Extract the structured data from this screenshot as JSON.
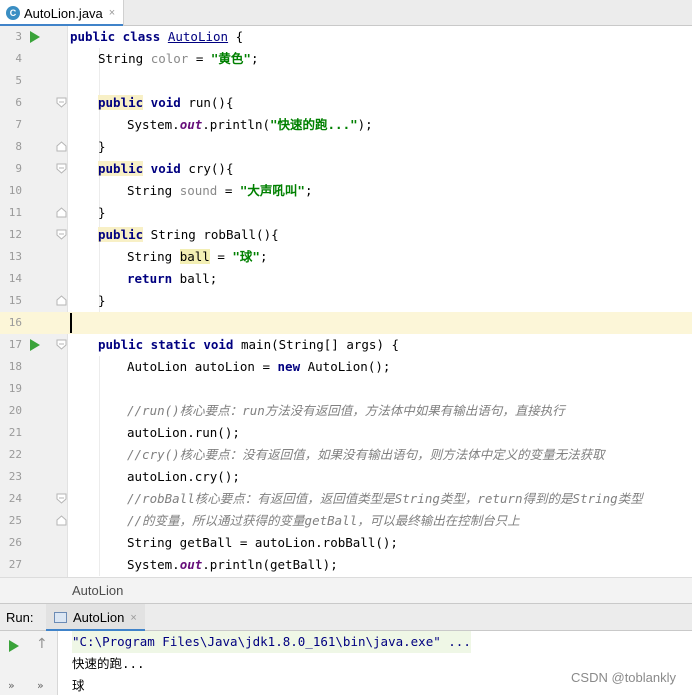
{
  "editor": {
    "tab": {
      "icon": "java-class-icon",
      "badge": "C",
      "label": "AutoLion.java",
      "close": "×"
    },
    "lines": [
      {
        "num": "3"
      },
      {
        "num": "4"
      },
      {
        "num": "5"
      },
      {
        "num": "6"
      },
      {
        "num": "7"
      },
      {
        "num": "8"
      },
      {
        "num": "9"
      },
      {
        "num": "10"
      },
      {
        "num": "11"
      },
      {
        "num": "12"
      },
      {
        "num": "13"
      },
      {
        "num": "14"
      },
      {
        "num": "15"
      },
      {
        "num": "16"
      },
      {
        "num": "17"
      },
      {
        "num": "18"
      },
      {
        "num": "19"
      },
      {
        "num": "20"
      },
      {
        "num": "21"
      },
      {
        "num": "22"
      },
      {
        "num": "23"
      },
      {
        "num": "24"
      },
      {
        "num": "25"
      },
      {
        "num": "26"
      },
      {
        "num": "27"
      }
    ],
    "code": {
      "l3": {
        "kw": "public class ",
        "cls": "AutoLion",
        "rest": " {"
      },
      "l4": {
        "type": "String ",
        "var": "color",
        "eq": " = ",
        "str": "\"黄色\"",
        "end": ";"
      },
      "l6": {
        "kw": "public",
        "kw2": " void",
        "rest": " run(){"
      },
      "l7": {
        "pre": "System.",
        "field": "out",
        "mid": ".println(",
        "str": "\"快速的跑...\"",
        "end": ");"
      },
      "l8": {
        "text": "}"
      },
      "l9": {
        "kw": "public",
        "kw2": " void",
        "rest": " cry(){"
      },
      "l10": {
        "type": "String ",
        "var": "sound",
        "eq": " = ",
        "str": "\"大声吼叫\"",
        "end": ";"
      },
      "l11": {
        "text": "}"
      },
      "l12": {
        "kw": "public",
        "rest": " String robBall(){"
      },
      "l13": {
        "type": "String ",
        "var": "ball",
        "eq": " = ",
        "str": "\"球\"",
        "end": ";"
      },
      "l14": {
        "kw": "return",
        "rest": " ball;"
      },
      "l15": {
        "text": "}"
      },
      "l17": {
        "kw": "public static void",
        "rest": " main(String[] args) {"
      },
      "l18": {
        "pre": "AutoLion autoLion = ",
        "kw": "new",
        "rest": " AutoLion();"
      },
      "l20": {
        "comment": "//run()核心要点：run方法没有返回值，方法体中如果有输出语句，直接执行"
      },
      "l21": {
        "text": "autoLion.run();"
      },
      "l22": {
        "comment": "//cry()核心要点：没有返回值，如果没有输出语句，则方法体中定义的变量无法获取"
      },
      "l23": {
        "text": "autoLion.cry();"
      },
      "l24": {
        "comment": "//robBall核心要点：有返回值，返回值类型是String类型，return得到的是String类型"
      },
      "l25": {
        "comment": "//的变量，所以通过获得的变量getBall，可以最终输出在控制台只上"
      },
      "l26": {
        "text": "String getBall = autoLion.robBall();"
      },
      "l27": {
        "pre": "System.",
        "field": "out",
        "rest": ".println(getBall);"
      }
    }
  },
  "breadcrumb": {
    "label": "AutoLion"
  },
  "run_panel": {
    "label": "Run:",
    "tab_label": "AutoLion",
    "tab_close": "×",
    "up_arrow": "↑",
    "more_left": "»",
    "more_right": "»",
    "console_lines": [
      "\"C:\\Program Files\\Java\\jdk1.8.0_161\\bin\\java.exe\" ...",
      "快速的跑...",
      "球"
    ]
  },
  "watermark": "CSDN @toblankly",
  "colors": {
    "keyword": "#000080",
    "string": "#008000",
    "field": "#660e7a",
    "comment": "#808080",
    "current_line": "#fcf6d8",
    "run_green": "#3aa33a",
    "tab_accent": "#4083c9"
  }
}
